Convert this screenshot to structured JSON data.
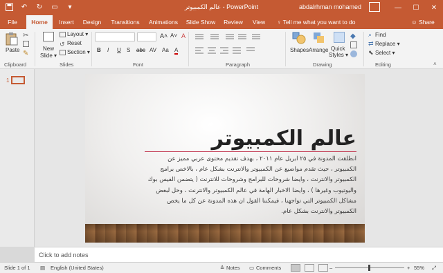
{
  "window": {
    "title": "عالم الكمبيوتر  -  PowerPoint",
    "user": "abdalrhman mohamed"
  },
  "qat": {
    "autosave_icon": "save-icon",
    "undo_icon": "undo-icon",
    "redo_icon": "redo-icon"
  },
  "tabs": [
    "File",
    "Home",
    "Insert",
    "Design",
    "Transitions",
    "Animations",
    "Slide Show",
    "Review",
    "View"
  ],
  "active_tab": "Home",
  "tell_me": "Tell me what you want to do",
  "share": "Share",
  "ribbon": {
    "clipboard": {
      "label": "Clipboard",
      "paste": "Paste"
    },
    "slides": {
      "label": "Slides",
      "new_slide": "New",
      "new_slide_2": "Slide ▾",
      "layout": "Layout ▾",
      "reset": "Reset",
      "section": "Section ▾"
    },
    "font": {
      "label": "Font",
      "bold": "B",
      "italic": "I",
      "underline": "U",
      "strike": "S",
      "shadow": "abc",
      "spacing": "AV",
      "case": "Aa",
      "highlight": "A"
    },
    "paragraph": {
      "label": "Paragraph"
    },
    "drawing": {
      "label": "Drawing",
      "shapes": "Shapes",
      "arrange": "Arrange",
      "quick_styles": "Quick",
      "quick_styles_2": "Styles ▾"
    },
    "editing": {
      "label": "Editing",
      "find": "Find",
      "replace": "Replace ▾",
      "select": "Select ▾"
    }
  },
  "thumbnail": {
    "number": "1"
  },
  "slide": {
    "title": "عالم الكمبيوتر",
    "body": "انطلقت المدونة في ٢٥ ابريل عام ٢٠١١ ، بهدف تقديم محتوى عربي مميز عن الكمبيوتر ، حيث تقدم مواضيع عن الكمبيوتر والانترنت بشكل عام ، بالاخص برامج الكمبيوتر والانترنت ، وايضا شروحات للبرامج وشروحات للانترنت ( يتضمن الفيس بوك واليوتيوب وغيرها ) ، وايضا الاخبار الهامة في عالم الكمبيوتر والانترنت ، وحل لبعض مشاكل الكمبيوتر التي تواجهنا ، فيمكننا القول ان هذه المدونة عن كل ما يخص الكمبيوتر والانترنت بشكل عام."
  },
  "notes": {
    "placeholder": "Click to add notes"
  },
  "status": {
    "slide_info": "Slide 1 of 1",
    "language": "English (United States)",
    "notes": "Notes",
    "comments": "Comments",
    "zoom": "55%",
    "minus": "–",
    "plus": "+"
  },
  "colors": {
    "accent": "#c55a33",
    "title_line": "#c0304a"
  }
}
